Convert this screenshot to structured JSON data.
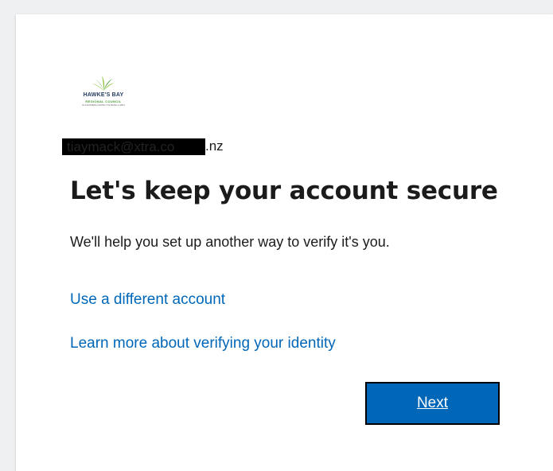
{
  "logo": {
    "name": "HAWKE'S BAY",
    "sub": "REGIONAL COUNCIL",
    "tagline": "TE KAUNIHERA Ā-ROHE O TE MATAU-A-MĀUI",
    "colors": {
      "primary": "#1f3a5f",
      "leaf": "#4a9a3a",
      "accent": "#8cc63f"
    }
  },
  "identity": {
    "redacted_part": "tiaymack@xtra.co",
    "suffix": ".nz"
  },
  "title": "Let's keep your account secure",
  "description": "We'll help you set up another way to verify it's you.",
  "links": {
    "different_account": "Use a different account",
    "learn_more": "Learn more about verifying your identity"
  },
  "next_button": "Next",
  "colors": {
    "link": "#0067b8",
    "button_bg": "#0067b8",
    "button_text": "#ffffff",
    "text": "#1b1b1b"
  }
}
